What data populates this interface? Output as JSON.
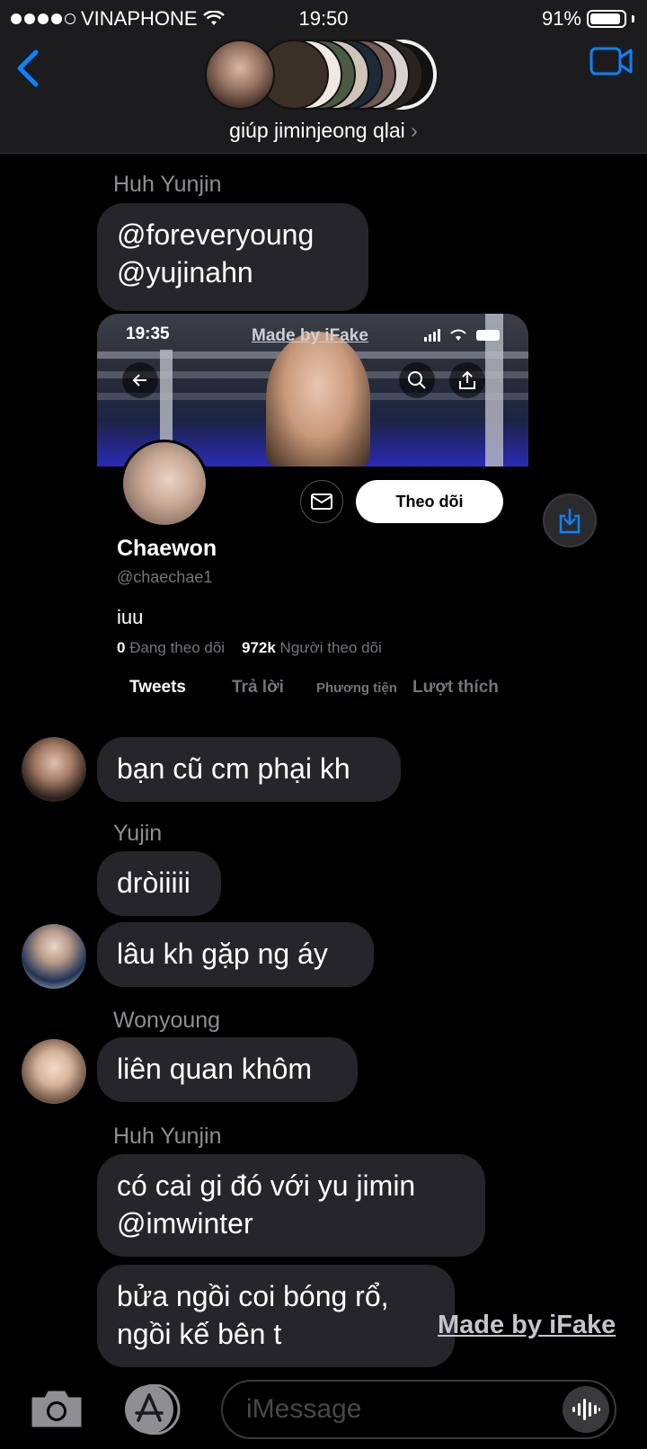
{
  "status_bar": {
    "carrier": "VINAPHONE",
    "time": "19:50",
    "battery_percent": "91%",
    "battery_level": 0.91
  },
  "header": {
    "group_name": "giúp jiminjeong qlai",
    "chevron": "›",
    "accent_color": "#0a84ff"
  },
  "messages": [
    {
      "sender": "Huh Yunjin",
      "lines": [
        "@foreveryoung",
        "@yujinahn"
      ]
    },
    {
      "text": "bạn cũ cm phại kh"
    },
    {
      "sender": "Yujin",
      "text": "dròiiiii"
    },
    {
      "text": "lâu kh gặp ng áy"
    },
    {
      "sender": "Wonyoung",
      "text": "liên quan khôm"
    },
    {
      "sender": "Huh Yunjin",
      "lines": [
        "có cai gi đó với yu jimin",
        "@imwinter"
      ]
    },
    {
      "lines": [
        "bửa ngồi coi bóng rổ,",
        "ngồi kế bên t"
      ]
    }
  ],
  "tweet_card": {
    "status_time": "19:35",
    "watermark": "Made by iFake",
    "name": "Chaewon",
    "handle": "@chaechae1",
    "bio": "iuu",
    "following_count": "0",
    "following_label": "Đang theo dõi",
    "followers_count": "972k",
    "followers_label": "Người theo dõi",
    "follow_button": "Theo dõi",
    "tabs": [
      "Tweets",
      "Trả lời",
      "Phương tiện",
      "Lượt thích"
    ]
  },
  "watermark": "Made by iFake",
  "input": {
    "placeholder": "iMessage"
  }
}
